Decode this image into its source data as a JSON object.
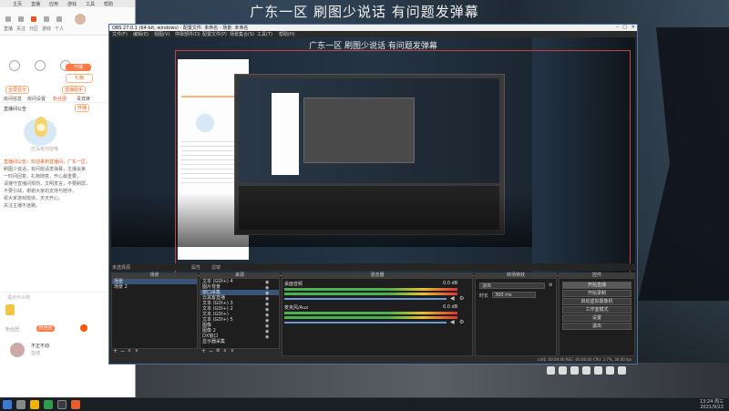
{
  "overlay_title": "广东一区 刷图少说话 有问题发弹幕",
  "browser": {
    "tabs": [
      "主页",
      "直播",
      "应用",
      "游戏",
      "工具",
      "帮助"
    ],
    "nav_items": [
      "直播",
      "关注",
      "分区",
      "游戏",
      "个人"
    ],
    "buttons": {
      "open_live": "开播",
      "gift": "礼物"
    },
    "link_left": "全屏显示",
    "link_right": "直播助手",
    "section_tabs": [
      "房间信息",
      "房间设置",
      "粉丝团",
      "贵宾席"
    ],
    "notice_label": "直播间公告",
    "mascot_caption": "还没有内容哦",
    "notice_text_lines": [
      "直播间公告：欢迎来到直播间，广东一区，",
      "刷图少说话，有问题请发弹幕，主播会第",
      "一时间回复。礼物随意，开心最重要，",
      "请遵守直播间规则，文明发言，不要刷屏，",
      "不要引战，谢谢大家的支持与陪伴，",
      "祝大家游戏愉快，天天开心。",
      "关注主播不迷路。"
    ],
    "chat_placeholder": "说点什么吧",
    "send_label": "发送",
    "fans_label": "粉丝团",
    "user_name": "不正不动",
    "user_status": "在线"
  },
  "obs": {
    "title": "OBS 27.0.1 (64-bit, windows) - 配置文件: 未命名 - 场景: 未命名",
    "menu": [
      "文件(F)",
      "编辑(E)",
      "视图(V)",
      "停靠部件(D)",
      "配置文件(P)",
      "场景集合(S)",
      "工具(T)",
      "帮助(H)"
    ],
    "preview_title": "广东一区 刷图少说话 有问题发弹幕",
    "bar_label": "未选择源",
    "bar_btn_props": "属性",
    "bar_btn_filters": "滤镜",
    "docks": {
      "scenes": "场景",
      "sources": "来源",
      "mixer": "混音器",
      "transitions": "转场特效",
      "controls": "控件"
    },
    "scenes": [
      "场景",
      "场景 2"
    ],
    "sources": [
      "文本 (GDI+) 4",
      "图片背景",
      "窗口采集",
      "云黑客直播",
      "文本 (GDI+) 3",
      "文本 (GDI+) 2",
      "文本 (GDI+)",
      "文本 (GDI+) 5",
      "图像",
      "图像 2",
      "DX窗口",
      "显示器采集"
    ],
    "mixer": [
      {
        "name": "桌面音频",
        "level": "0.0 dB"
      },
      {
        "name": "麦克风/Aux",
        "level": "0.0 dB"
      }
    ],
    "transition": {
      "type": "淡出",
      "duration_label": "时长",
      "duration": "300 ms"
    },
    "controls": [
      "开始直播",
      "开始录制",
      "启动虚拟摄像机",
      "工作室模式",
      "设置",
      "退出"
    ],
    "status": "LIVE: 00:00:00   REC: 00:00:00   CPU: 3.7%, 30.00 fps"
  },
  "taskbar": {
    "time": "13:24 周三",
    "date": "2021/9/22"
  },
  "colors": {
    "accent": "#ff7a45",
    "obs_select": "#3a5478"
  }
}
